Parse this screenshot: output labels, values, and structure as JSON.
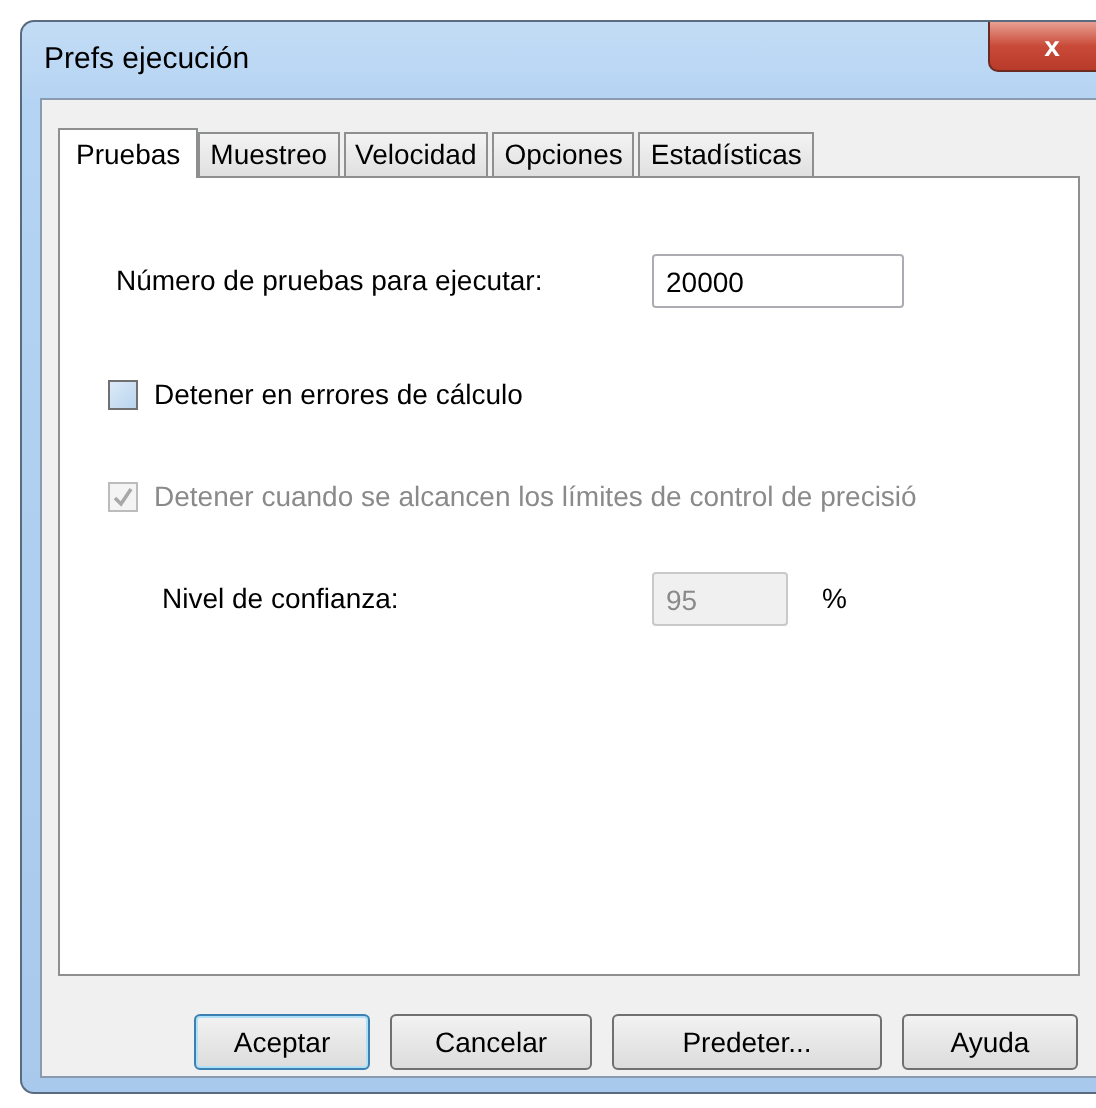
{
  "window": {
    "title": "Prefs ejecución",
    "close": "x"
  },
  "tabs": [
    {
      "label": "Pruebas",
      "selected": true
    },
    {
      "label": "Muestreo",
      "selected": false
    },
    {
      "label": "Velocidad",
      "selected": false
    },
    {
      "label": "Opciones",
      "selected": false
    },
    {
      "label": "Estadísticas",
      "selected": false
    }
  ],
  "trials": {
    "label": "Número de pruebas para ejecutar:",
    "value": "20000"
  },
  "checkboxes": [
    {
      "label": "Detener en errores de cálculo",
      "checked": false,
      "disabled": false
    },
    {
      "label": "Detener cuando se alcancen los límites de control de precisió",
      "checked": true,
      "disabled": true
    }
  ],
  "confidence": {
    "label": "Nivel de confianza:",
    "value": "95",
    "unit": "%",
    "disabled": true
  },
  "buttons": [
    {
      "label": "Aceptar",
      "default": true
    },
    {
      "label": "Cancelar",
      "default": false
    },
    {
      "label": "Predeter...",
      "default": false
    },
    {
      "label": "Ayuda",
      "default": false
    }
  ]
}
